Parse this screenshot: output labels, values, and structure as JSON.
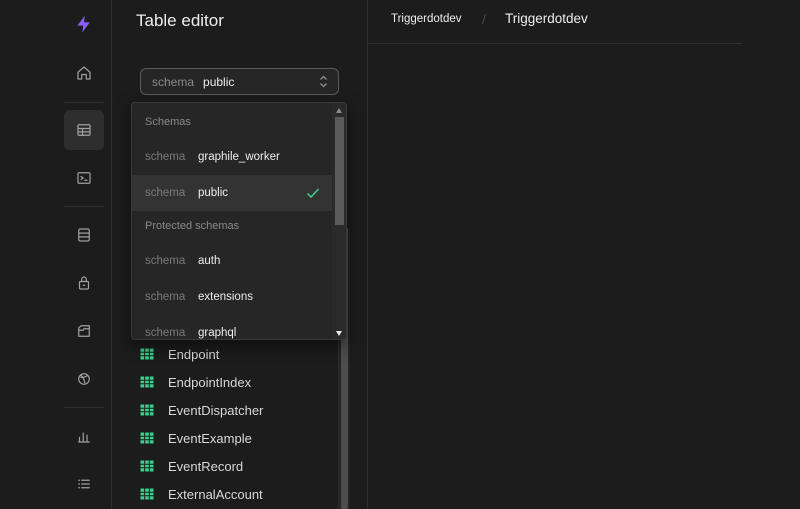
{
  "rail": {
    "icons": [
      "bolt-logo-icon",
      "home-icon",
      "table-editor-icon",
      "sql-editor-icon",
      "database-icon",
      "auth-lock-icon",
      "storage-icon",
      "realtime-icon",
      "reports-icon",
      "logs-icon"
    ],
    "accent": "#8b5cf6"
  },
  "panel": {
    "title": "Table editor",
    "schema_select": {
      "key": "schema",
      "value": "public"
    },
    "tables": [
      "Endpoint",
      "EndpointIndex",
      "EventDispatcher",
      "EventExample",
      "EventRecord",
      "ExternalAccount"
    ]
  },
  "dropdown": {
    "groups": {
      "schemas": "Schemas",
      "protected": "Protected schemas"
    },
    "items": [
      {
        "key": "schema",
        "value": "graphile_worker",
        "selected": false
      },
      {
        "key": "schema",
        "value": "public",
        "selected": true
      },
      {
        "key": "schema",
        "value": "auth",
        "selected": false
      },
      {
        "key": "schema",
        "value": "extensions",
        "selected": false
      },
      {
        "key": "schema",
        "value": "graphql",
        "selected": false
      }
    ]
  },
  "breadcrumb": {
    "org": "Triggerdotdev",
    "separator": "/",
    "project": "Triggerdotdev"
  },
  "colors": {
    "check": "#3ecf8e",
    "table_icon": "#3ecf8e",
    "background": "#1c1c1c"
  }
}
